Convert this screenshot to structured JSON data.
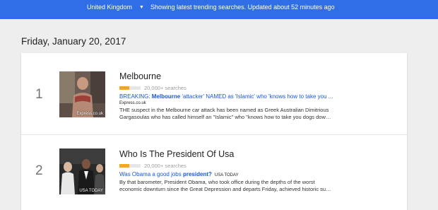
{
  "header": {
    "region": "United Kingdom",
    "status": "Showing latest trending searches. Updated about 52 minutes ago"
  },
  "date": "Friday, January 20, 2017",
  "trends": [
    {
      "rank": "1",
      "title": "Melbourne",
      "volume": "20,000+ searches",
      "volume_fraction": 0.45,
      "headline_prefix": "BREAKING: ",
      "headline_keyword": "Melbourne",
      "headline_rest": " 'attacker' NAMED as 'Islamic' who 'knows how to take you ...",
      "source": "Express.co.uk",
      "snippet_line1": "THE suspect in the Melbourne car attack has been named as Greek Australian Dimitrious",
      "snippet_line2": "Gargasoulas who has called himself an \"Islamic\" who \"knows how to take you dogs dow…",
      "image_caption": "Express.co.uk"
    },
    {
      "rank": "2",
      "title": "Who Is The President Of Usa",
      "volume": "20,000+ searches",
      "volume_fraction": 0.45,
      "headline_prefix": "Was Obama a good jobs ",
      "headline_keyword": "president?",
      "headline_rest": "",
      "source": "USA TODAY",
      "snippet_line1": "By that barometer, President Obama, who took office during the depths of the worst",
      "snippet_line2": "economic downturn since the Great Depression and departs Friday, achieved historic su…",
      "image_caption": "USA TODAY"
    }
  ],
  "colors": {
    "header_bg": "#2f6ee6",
    "link": "#1a56d6",
    "volume_bar": "#f5a623"
  },
  "icons": {
    "region_dropdown": "caret-down-icon"
  }
}
